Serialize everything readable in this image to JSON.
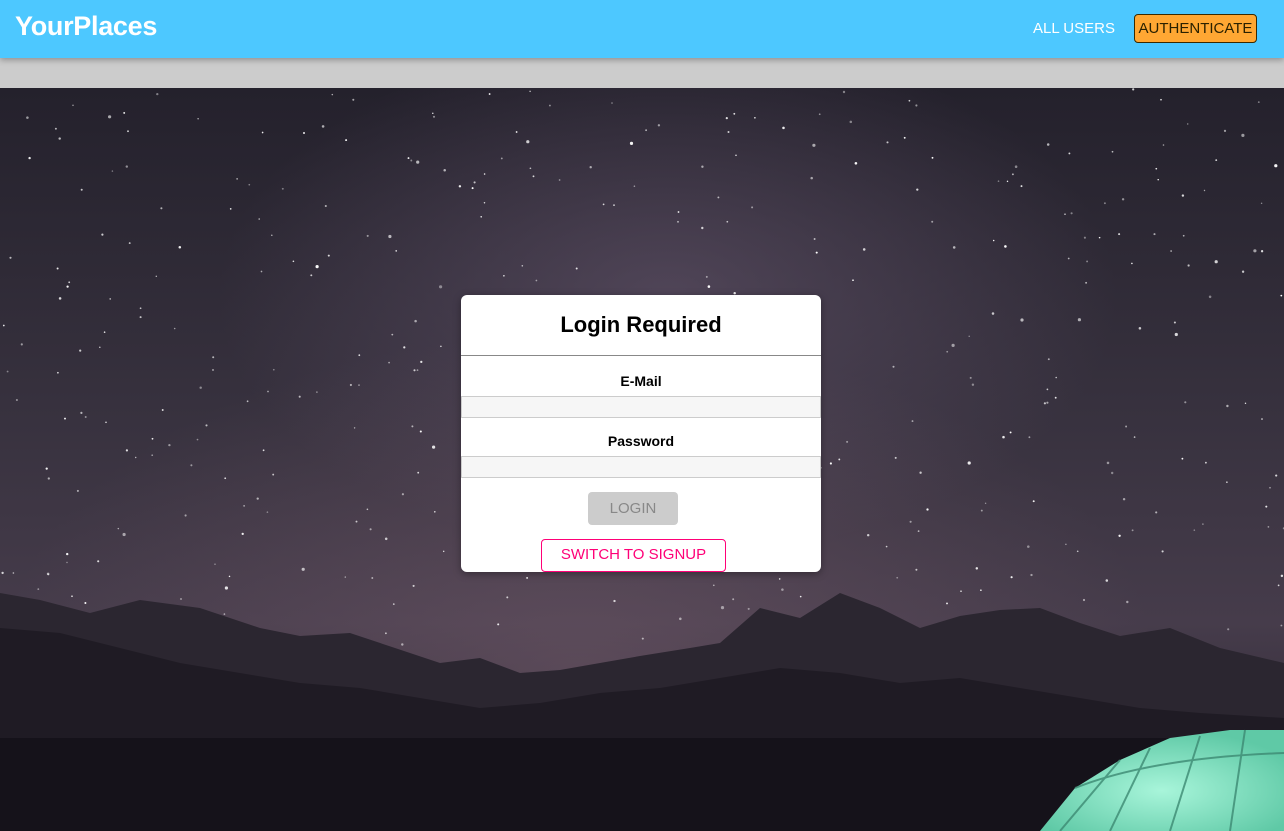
{
  "header": {
    "logo": "YourPlaces",
    "nav_all_users": "ALL USERS",
    "nav_authenticate": "AUTHENTICATE"
  },
  "modal": {
    "title": "Login Required",
    "email_label": "E-Mail",
    "email_value": "",
    "password_label": "Password",
    "password_value": "",
    "login_button": "LOGIN",
    "switch_button": "SWITCH TO SIGNUP"
  },
  "colors": {
    "header": "#4dc8ff",
    "authenticate_button": "#ffa733",
    "switch_button_accent": "#ff0077",
    "disabled_button": "#cccccc",
    "tent": "#7fe5c4"
  }
}
